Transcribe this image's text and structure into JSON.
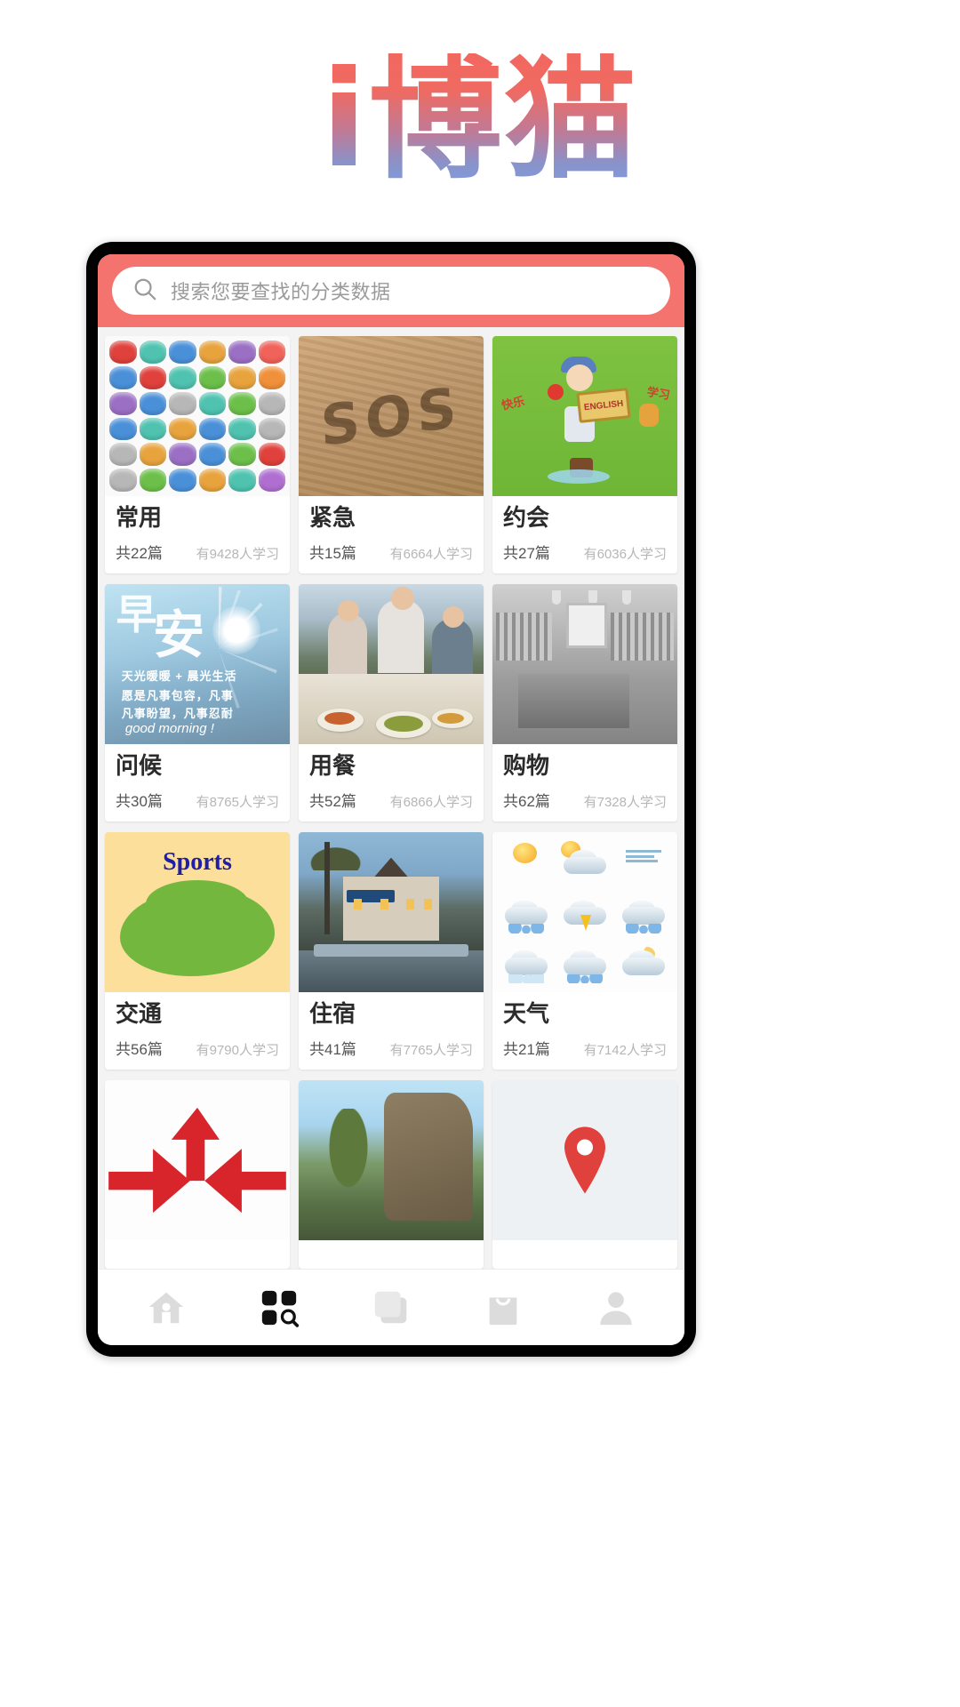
{
  "app": {
    "brand_title": "i博猫"
  },
  "search": {
    "placeholder": "搜索您要查找的分类数据",
    "value": "",
    "icon": "search-icon",
    "bar_color": "#f4736e"
  },
  "categories": [
    {
      "title": "常用",
      "count_label": "共22篇",
      "learners_label": "有9428人学习",
      "thumb": "icon-sheet-image"
    },
    {
      "title": "紧急",
      "count_label": "共15篇",
      "learners_label": "有6664人学习",
      "thumb": "sand-sos-image"
    },
    {
      "title": "约会",
      "count_label": "共27篇",
      "learners_label": "有6036人学习",
      "thumb": "english-girl-image"
    },
    {
      "title": "问候",
      "count_label": "共30篇",
      "learners_label": "有8765人学习",
      "thumb": "good-morning-image"
    },
    {
      "title": "用餐",
      "count_label": "共52篇",
      "learners_label": "有6866人学习",
      "thumb": "dining-friends-image"
    },
    {
      "title": "购物",
      "count_label": "共62篇",
      "learners_label": "有7328人学习",
      "thumb": "store-interior-image"
    },
    {
      "title": "交通",
      "count_label": "共56篇",
      "learners_label": "有9790人学习",
      "thumb": "sports-poster-image"
    },
    {
      "title": "住宿",
      "count_label": "共41篇",
      "learners_label": "有7765人学习",
      "thumb": "hotel-dusk-image"
    },
    {
      "title": "天气",
      "count_label": "共21篇",
      "learners_label": "有7142人学习",
      "thumb": "weather-icons-image"
    },
    {
      "title": "",
      "count_label": "",
      "learners_label": "",
      "thumb": "red-arrows-image"
    },
    {
      "title": "",
      "count_label": "",
      "learners_label": "",
      "thumb": "landscape-image"
    },
    {
      "title": "",
      "count_label": "",
      "learners_label": "",
      "thumb": "location-pin-image"
    }
  ],
  "bottom_nav": {
    "items": [
      {
        "icon": "home-icon",
        "active": false
      },
      {
        "icon": "grid-search-icon",
        "active": true
      },
      {
        "icon": "layers-icon",
        "active": false
      },
      {
        "icon": "shopping-bag-icon",
        "active": false
      },
      {
        "icon": "user-icon",
        "active": false
      }
    ],
    "active_color": "#111111",
    "inactive_color": "#dcdcdc"
  },
  "sports_art": {
    "heading": "Sports"
  },
  "sos_art": {
    "text": "SOS"
  },
  "morning_art": {
    "zao": "早",
    "an": "安",
    "line1": "天光暖暖 + 晨光生活",
    "line2": "愿是凡事包容，凡事",
    "line3": "凡事盼望，凡事忍耐",
    "signature": "good morning !"
  },
  "english_art": {
    "sign_text": "ENGLISH",
    "left_word": "快乐",
    "right_word": "学习"
  },
  "icon_sheet": {
    "colors": [
      "#e0413c",
      "#4fc3b0",
      "#4a90d9",
      "#e8a33d",
      "#9b6fc4",
      "#f0625a",
      "#4a90d9",
      "#e0413c",
      "#4fc3b0",
      "#6cc04a",
      "#e8a33d",
      "#f0903a",
      "#9b6fc4",
      "#4a90d9",
      "#b7b7b7",
      "#4fc3b0",
      "#6cc04a",
      "#b7b7b7",
      "#4a90d9",
      "#4fc3b0",
      "#e8a33d",
      "#4a90d9",
      "#4fc3b0",
      "#b7b7b7",
      "#b7b7b7",
      "#e8a33d",
      "#9b6fc4",
      "#4a90d9",
      "#6cc04a",
      "#e0413c",
      "#b7b7b7",
      "#6cc04a",
      "#4a90d9",
      "#e8a33d",
      "#4fc3b0",
      "#b06fd0"
    ]
  }
}
